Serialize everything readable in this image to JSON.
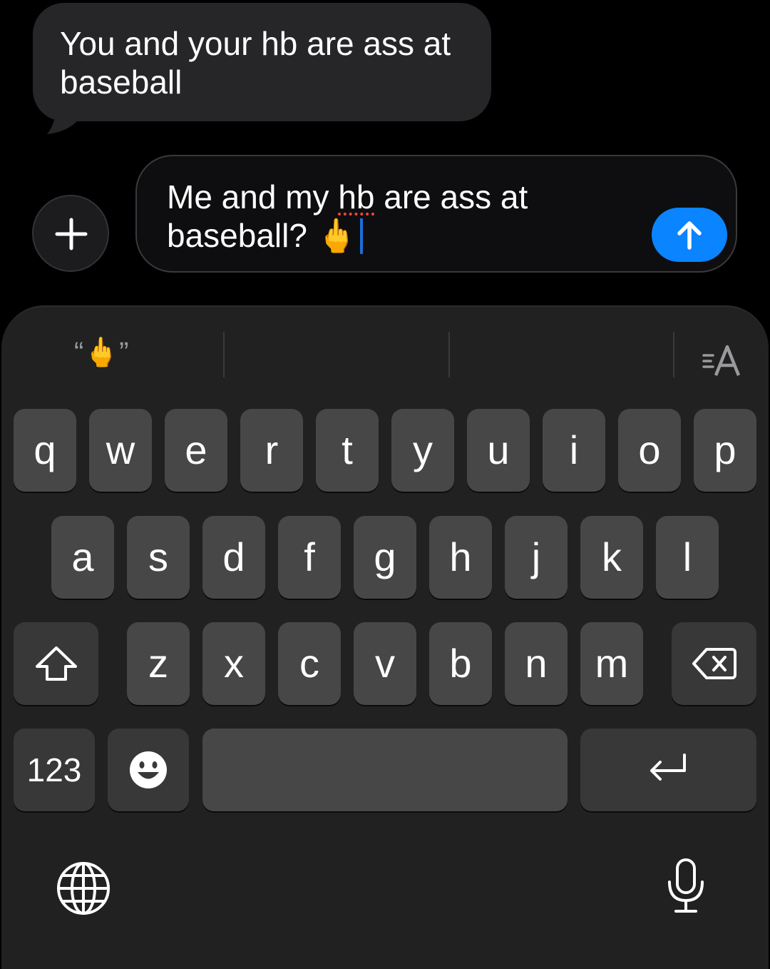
{
  "conversation": {
    "incoming_message": "You and your hb are ass at baseball"
  },
  "composer": {
    "text_before": "Me and my ",
    "misspelled_word": "hb",
    "text_after": " are ass at baseball? ",
    "emoji": "🖕",
    "add_icon": "plus-icon",
    "send_icon": "arrow-up-icon",
    "send_color": "#0a84ff"
  },
  "suggestions": {
    "items": [
      "“🖕”",
      "",
      ""
    ],
    "format_icon": "text-format-icon",
    "format_label": "≡A"
  },
  "keyboard": {
    "row1": [
      "q",
      "w",
      "e",
      "r",
      "t",
      "y",
      "u",
      "i",
      "o",
      "p"
    ],
    "row2": [
      "a",
      "s",
      "d",
      "f",
      "g",
      "h",
      "j",
      "k",
      "l"
    ],
    "row3": [
      "z",
      "x",
      "c",
      "v",
      "b",
      "n",
      "m"
    ],
    "numbers_label": "123",
    "shift_icon": "shift-icon",
    "delete_icon": "delete-icon",
    "emoji_icon": "emoji-icon",
    "return_icon": "return-icon",
    "globe_icon": "globe-icon",
    "mic_icon": "microphone-icon",
    "space_label": ""
  }
}
